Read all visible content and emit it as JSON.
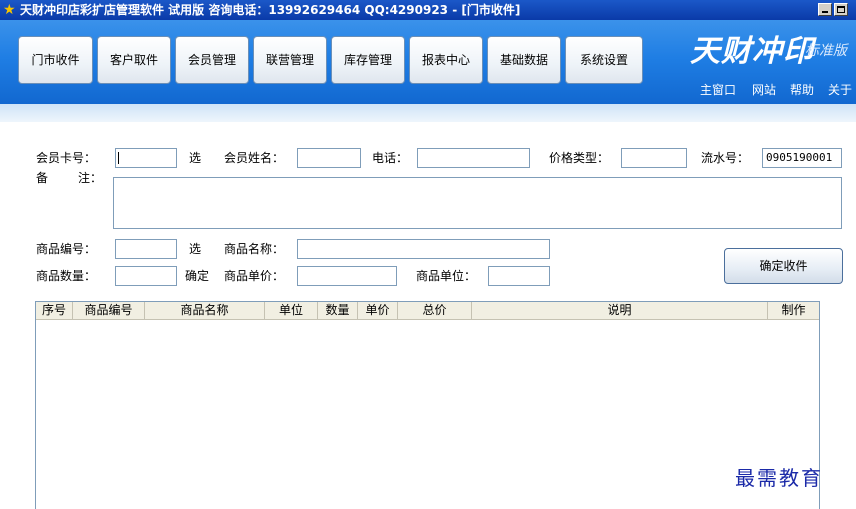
{
  "window": {
    "title": "天财冲印店彩扩店管理软件  试用版  咨询电话：13992629464  QQ:4290923 - [门市收件]"
  },
  "nav": [
    {
      "label": "门市收件"
    },
    {
      "label": "客户取件"
    },
    {
      "label": "会员管理"
    },
    {
      "label": "联营管理"
    },
    {
      "label": "库存管理"
    },
    {
      "label": "报表中心"
    },
    {
      "label": "基础数据"
    },
    {
      "label": "系统设置"
    }
  ],
  "logo": {
    "main": "天财冲印",
    "sub": "标准版"
  },
  "toplinks": [
    {
      "label": "主窗口"
    },
    {
      "label": "网站"
    },
    {
      "label": "帮助"
    },
    {
      "label": "关于"
    }
  ],
  "form": {
    "card_no_label": "会员卡号：",
    "select1_label": "选",
    "member_name_label": "会员姓名：",
    "phone_label": "电话：",
    "price_type_label": "价格类型：",
    "serial_label": "流水号：",
    "serial_value": "0905190001",
    "note_label_1": "备",
    "note_label_2": "注：",
    "product_code_label": "商品编号：",
    "select2_label": "选",
    "product_name_label": "商品名称：",
    "product_qty_label": "商品数量：",
    "confirm_label": "确定",
    "unit_price_label": "商品单价：",
    "unit_label": "商品单位：",
    "confirm_receive_button": "确定收件"
  },
  "table": {
    "columns": [
      "序号",
      "商品编号",
      "商品名称",
      "单位",
      "数量",
      "单价",
      "总价",
      "说明",
      "制作"
    ],
    "rows": []
  },
  "watermark": "最需教育"
}
